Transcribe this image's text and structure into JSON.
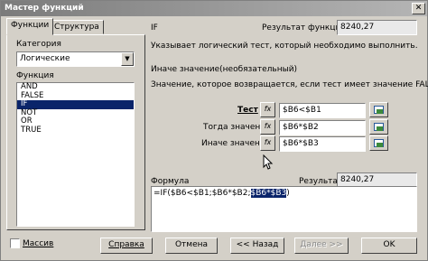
{
  "window": {
    "title": "Мастер функций"
  },
  "tabs": [
    {
      "label": "Функции",
      "active": true
    },
    {
      "label": "Структура",
      "active": false
    }
  ],
  "left_panel": {
    "category_label": "Категория",
    "category_value": "Логические",
    "function_label": "Функция",
    "functions": [
      "AND",
      "FALSE",
      "IF",
      "NOT",
      "OR",
      "TRUE"
    ],
    "selected_function": "IF"
  },
  "function_info": {
    "name": "IF",
    "result_label": "Результат функции",
    "result_value": "8240,27",
    "description": "Указывает логический тест, который необходимо выполнить.",
    "param_title": "Иначе значение(необязательный)",
    "param_description": "Значение, которое возвращается, если тест имеет значение FALSE."
  },
  "arguments": [
    {
      "label": "Тест",
      "bold": true,
      "value": "$B6<$B1"
    },
    {
      "label": "Тогда значение",
      "bold": false,
      "value": "$B6*$B2"
    },
    {
      "label": "Иначе значение",
      "bold": false,
      "value": "$B6*$B3"
    }
  ],
  "fx_label": "fx",
  "formula": {
    "label": "Формула",
    "result_label": "Результат",
    "result_value": "8240,27",
    "text_plain": "=IF($B6<$B1;$B6*$B2;",
    "text_highlight": "$B6*$B3",
    "text_end": ")"
  },
  "checkbox": {
    "label": "Массив",
    "checked": false
  },
  "buttons": {
    "help": "Справка",
    "cancel": "Отмена",
    "back": "<< Назад",
    "next": "Далее >>",
    "ok": "OK"
  },
  "colors": {
    "selection": "#0a246a",
    "face": "#d4d0c8"
  }
}
